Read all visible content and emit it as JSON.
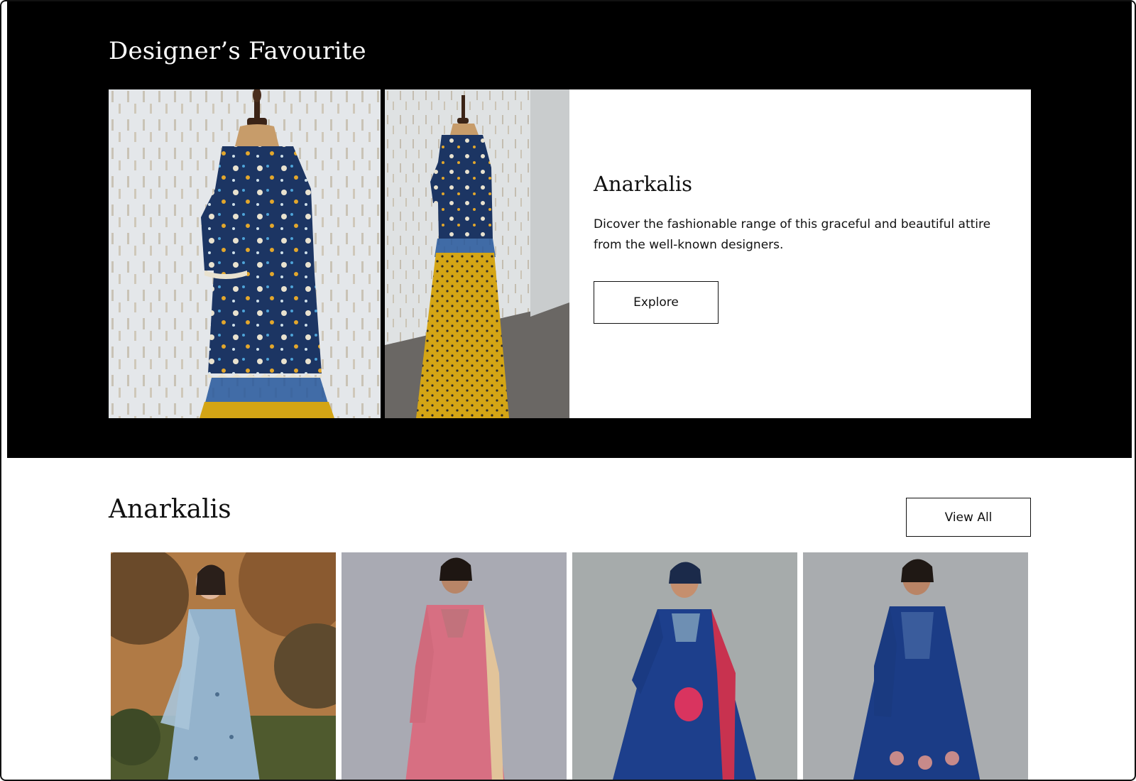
{
  "featured": {
    "title": "Designer’s Favourite",
    "card": {
      "heading": "Anarkalis",
      "description": "Dicover the fashionable range of this graceful and beautiful attire from the well-known designers.",
      "button_label": "Explore"
    }
  },
  "collection": {
    "title": "Anarkalis",
    "view_all_label": "View All",
    "products": [
      {
        "color": "light-blue"
      },
      {
        "color": "pink"
      },
      {
        "color": "royal-blue"
      },
      {
        "color": "royal-blue"
      }
    ]
  },
  "colors": {
    "accent": "#000000",
    "navy_top": "#1d3a6b",
    "mustard": "#d4a515"
  }
}
